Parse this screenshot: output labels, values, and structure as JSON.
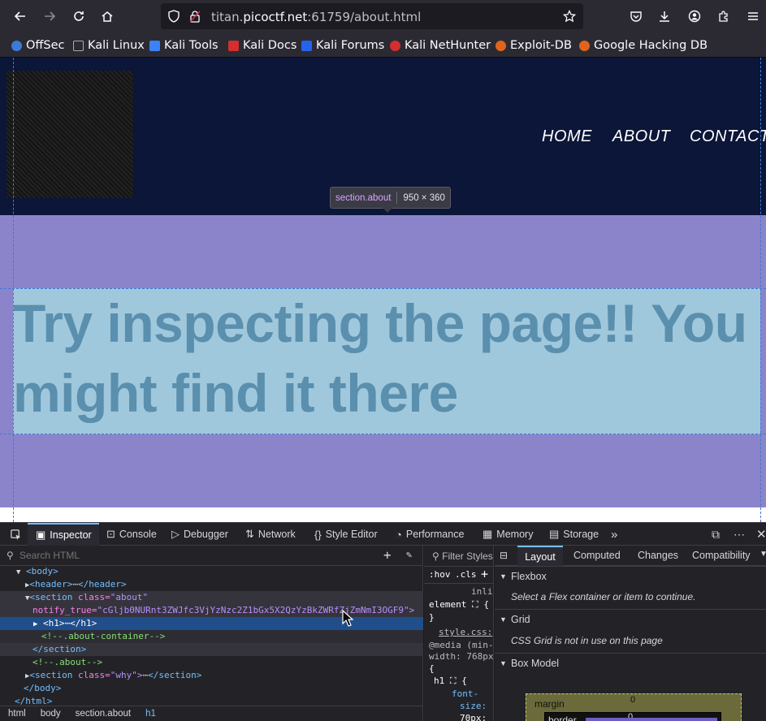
{
  "browser": {
    "url_host_pre": "titan.",
    "url_host": "picoctf.net",
    "url_rest": ":61759/about.html",
    "bookmarks": [
      "OffSec",
      "Kali Linux",
      "Kali Tools",
      "Kali Docs",
      "Kali Forums",
      "Kali NetHunter",
      "Exploit-DB",
      "Google Hacking DB"
    ]
  },
  "site": {
    "nav": [
      "HOME",
      "ABOUT",
      "CONTACT"
    ],
    "heading": "Try inspecting the page!! You might find it there"
  },
  "tooltip": {
    "selector": "section.about",
    "size": "950 × 360"
  },
  "devtools": {
    "tabs": [
      "Inspector",
      "Console",
      "Debugger",
      "Network",
      "Style Editor",
      "Performance",
      "Memory",
      "Storage"
    ],
    "search_placeholder": "Search HTML",
    "markup": {
      "body_open": "<body>",
      "header": "<header>",
      "header_close": "</header>",
      "section_open": "<section",
      "class_attr": "class=",
      "class_val": "\"about\"",
      "notify_attr": "notify_true=",
      "notify_val": "\"cGljb0NURnt3ZWJfc3VjYzNzc2Z1bGx5X2QzYzBkZWRfZjZmNmI3OGF9\">",
      "h1_open": "<h1>",
      "h1_close": "</h1>",
      "comment1": "<!--.about-container-->",
      "section_close": "</section>",
      "comment2": "<!--.about-->",
      "why_val": "\"why\">",
      "body_close": "</body>",
      "html_close": "</html>"
    },
    "breadcrumbs": [
      "html",
      "body",
      "section.about",
      "h1"
    ],
    "rules": {
      "filter": "Filter Styles",
      "hov": ":hov",
      "cls": ".cls",
      "inline": "inli",
      "element": "element",
      "file": "style.css:",
      "media": "@media (min-",
      "width": "width: 768px",
      "brace": "{",
      "h1sel": "h1",
      "prop1": "font-",
      "prop2": "size:",
      "val": "70px;"
    },
    "layout": {
      "tabs": [
        "Layout",
        "Computed",
        "Changes",
        "Compatibility"
      ],
      "flexbox": "Flexbox",
      "flex_note": "Select a Flex container or item to continue.",
      "grid": "Grid",
      "grid_note": "CSS Grid is not in use on this page",
      "boxmodel": "Box Model",
      "margin": "margin",
      "border": "border",
      "zero": "0"
    }
  }
}
